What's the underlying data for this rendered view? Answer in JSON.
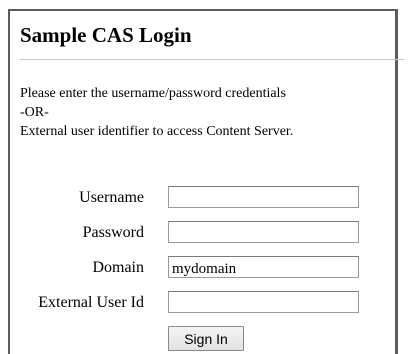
{
  "login": {
    "title": "Sample CAS Login",
    "instructions": {
      "line1": "Please enter the username/password credentials",
      "line2": "-OR-",
      "line3": "External user identifier to access Content Server."
    },
    "fields": {
      "username": {
        "label": "Username",
        "value": ""
      },
      "password": {
        "label": "Password",
        "value": ""
      },
      "domain": {
        "label": "Domain",
        "value": "mydomain"
      },
      "external_user_id": {
        "label": "External User Id",
        "value": ""
      }
    },
    "sign_in_label": "Sign In"
  }
}
